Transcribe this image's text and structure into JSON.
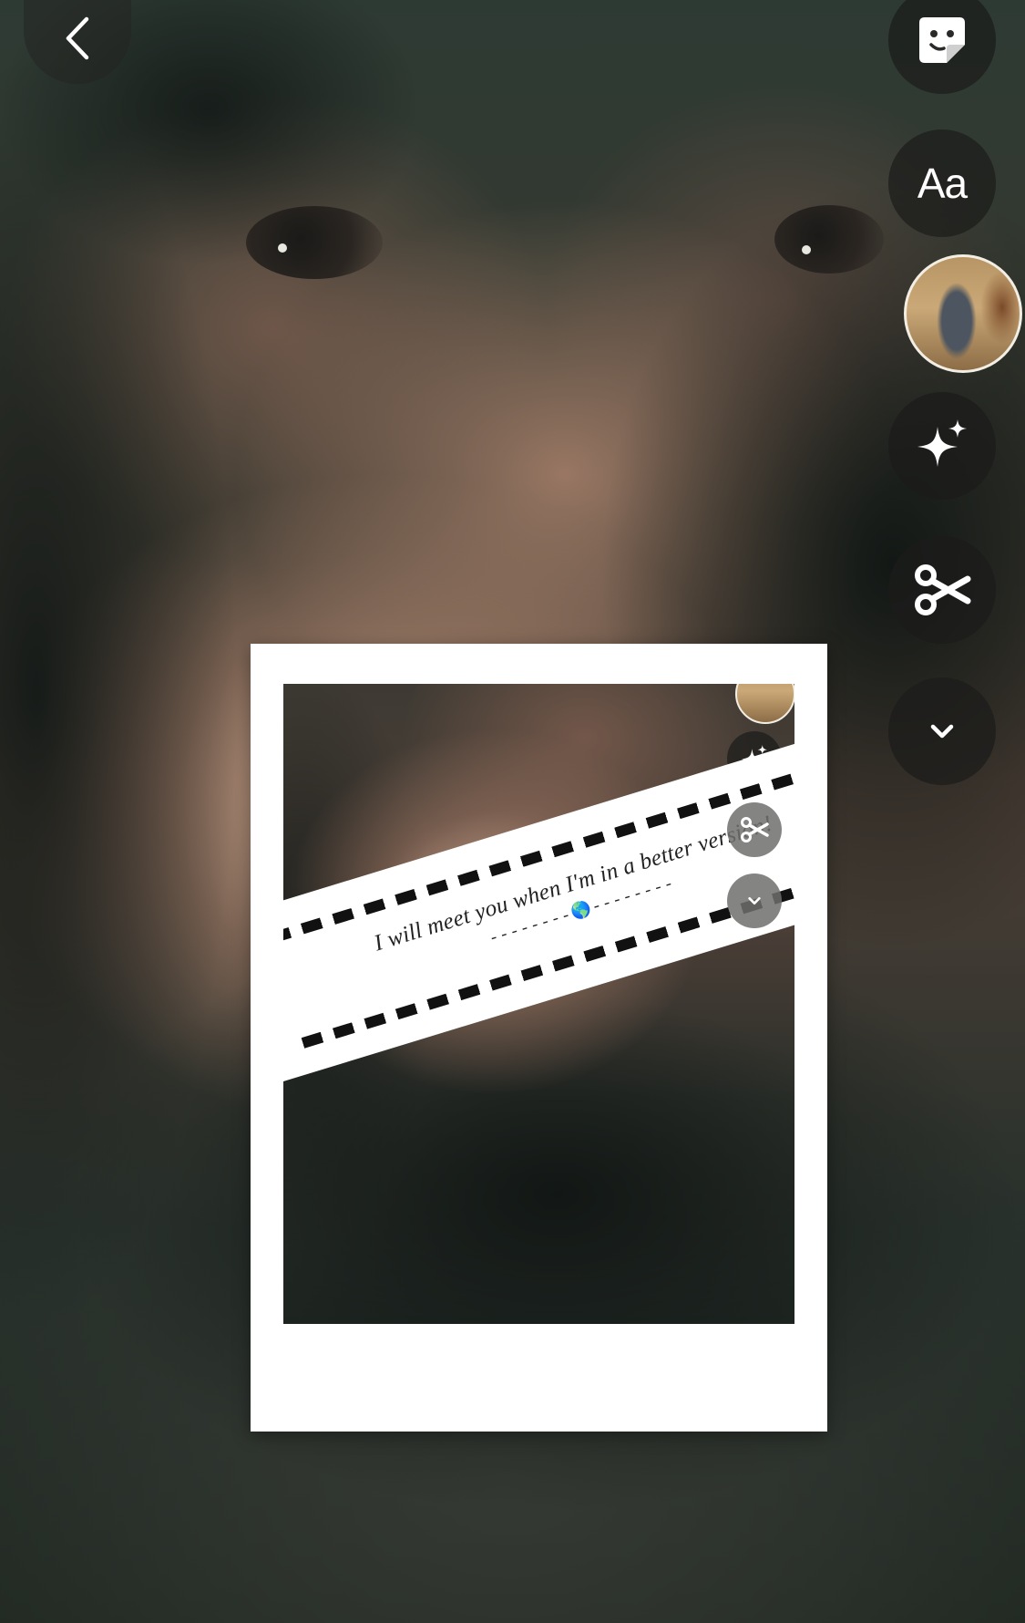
{
  "toolbar": {
    "back_icon": "chevron-left-icon",
    "buttons": [
      {
        "name": "sticker-button",
        "icon": "sticker-icon"
      },
      {
        "name": "text-tool-button",
        "icon": "text-icon",
        "label": "Aa"
      },
      {
        "name": "effects-button",
        "icon": "sparkle-icon"
      },
      {
        "name": "cutout-button",
        "icon": "scissors-icon"
      },
      {
        "name": "more-tools-button",
        "icon": "chevron-down-icon"
      }
    ]
  },
  "sticker": {
    "quote_line": "I will meet you when I'm in a better version!",
    "quote_sub": "--------🌎--------"
  },
  "colors": {
    "panel_bg": "#ffffff",
    "button_bg": "#1c1c1b",
    "icon": "#ffffff",
    "dash": "#111111"
  }
}
